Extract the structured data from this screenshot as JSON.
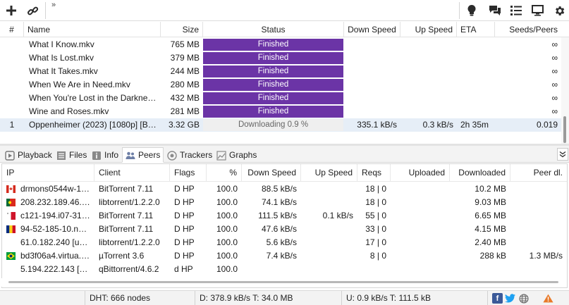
{
  "toolbar": {
    "left_icons": [
      "plus-icon",
      "link-icon"
    ],
    "overflow_label": "»",
    "right_icons": [
      "lightbulb-icon",
      "chat-icon",
      "list-icon",
      "monitor-icon",
      "gear-icon"
    ]
  },
  "torrents": {
    "columns": [
      "#",
      "Name",
      "Size",
      "Status",
      "Down Speed",
      "Up Speed",
      "ETA",
      "Seeds/Peers"
    ],
    "rows": [
      {
        "num": "",
        "name": "What I Know.mkv",
        "size": "765 MB",
        "status": "Finished",
        "state": "finished",
        "progress": 1.0,
        "down": "",
        "up": "",
        "eta": "",
        "seeds": "∞"
      },
      {
        "num": "",
        "name": "What Is Lost.mkv",
        "size": "379 MB",
        "status": "Finished",
        "state": "finished",
        "progress": 1.0,
        "down": "",
        "up": "",
        "eta": "",
        "seeds": "∞"
      },
      {
        "num": "",
        "name": "What It Takes.mkv",
        "size": "244 MB",
        "status": "Finished",
        "state": "finished",
        "progress": 1.0,
        "down": "",
        "up": "",
        "eta": "",
        "seeds": "∞"
      },
      {
        "num": "",
        "name": "When We Are in Need.mkv",
        "size": "280 MB",
        "status": "Finished",
        "state": "finished",
        "progress": 1.0,
        "down": "",
        "up": "",
        "eta": "",
        "seeds": "∞"
      },
      {
        "num": "",
        "name": "When You're Lost in the Darkness....",
        "size": "432 MB",
        "status": "Finished",
        "state": "finished",
        "progress": 1.0,
        "down": "",
        "up": "",
        "eta": "",
        "seeds": "∞"
      },
      {
        "num": "",
        "name": "Wine and Roses.mkv",
        "size": "281 MB",
        "status": "Finished",
        "state": "finished",
        "progress": 1.0,
        "down": "",
        "up": "",
        "eta": "",
        "seeds": "∞"
      },
      {
        "num": "1",
        "name": "Oppenheimer (2023) [1080p] [Blu...",
        "size": "3.32 GB",
        "status": "Downloading 0.9 %",
        "state": "downloading",
        "progress": 0.009,
        "down": "335.1 kB/s",
        "up": "0.3 kB/s",
        "eta": "2h 35m",
        "seeds": "0.019"
      }
    ]
  },
  "tabs": [
    {
      "label": "Playback",
      "icon": "playback-icon"
    },
    {
      "label": "Files",
      "icon": "files-icon"
    },
    {
      "label": "Info",
      "icon": "info-icon"
    },
    {
      "label": "Peers",
      "icon": "peers-icon",
      "active": true
    },
    {
      "label": "Trackers",
      "icon": "trackers-icon"
    },
    {
      "label": "Graphs",
      "icon": "graphs-icon"
    }
  ],
  "peers": {
    "columns": [
      "IP",
      "Client",
      "Flags",
      "%",
      "Down Speed",
      "Up Speed",
      "Reqs",
      "Uploaded",
      "Downloaded",
      "Peer dl."
    ],
    "rows": [
      {
        "flag": "ca",
        "ip": "drmons0544w-156....",
        "client": "BitTorrent 7.11",
        "flags": "D HP",
        "pct": "100.0",
        "down": "88.5 kB/s",
        "up": "",
        "reqs": "18 | 0",
        "uploaded": "",
        "downloaded": "10.2 MB",
        "peer_dl": ""
      },
      {
        "flag": "pt",
        "ip": "208.232.189.46.rev....",
        "client": "libtorrent/1.2.2.0",
        "flags": "D HP",
        "pct": "100.0",
        "down": "74.1 kB/s",
        "up": "",
        "reqs": "18 | 0",
        "uploaded": "",
        "downloaded": "9.03 MB",
        "peer_dl": ""
      },
      {
        "flag": "mt",
        "ip": "c121-194.i07-31.o...",
        "client": "BitTorrent 7.11",
        "flags": "D HP",
        "pct": "100.0",
        "down": "111.5 kB/s",
        "up": "0.1 kB/s",
        "reqs": "55 | 0",
        "uploaded": "",
        "downloaded": "6.65 MB",
        "peer_dl": ""
      },
      {
        "flag": "ro",
        "ip": "94-52-185-10.next...",
        "client": "BitTorrent 7.11",
        "flags": "D HP",
        "pct": "100.0",
        "down": "47.6 kB/s",
        "up": "",
        "reqs": "33 | 0",
        "uploaded": "",
        "downloaded": "4.15 MB",
        "peer_dl": ""
      },
      {
        "flag": "",
        "ip": "61.0.182.240 [uTP]",
        "client": "libtorrent/1.2.2.0",
        "flags": "D HP",
        "pct": "100.0",
        "down": "5.6 kB/s",
        "up": "",
        "reqs": "17 | 0",
        "uploaded": "",
        "downloaded": "2.40 MB",
        "peer_dl": ""
      },
      {
        "flag": "br",
        "ip": "bd3f06a4.virtua.co....",
        "client": "µTorrent 3.6",
        "flags": "D HP",
        "pct": "100.0",
        "down": "7.4 kB/s",
        "up": "",
        "reqs": "8 | 0",
        "uploaded": "",
        "downloaded": "288 kB",
        "peer_dl": "1.3 MB/s"
      },
      {
        "flag": "",
        "ip": "5.194.222.143 [uTP]",
        "client": "qBittorrent/4.6.2",
        "flags": "d HP",
        "pct": "100.0",
        "down": "",
        "up": "",
        "reqs": "",
        "uploaded": "",
        "downloaded": "",
        "peer_dl": ""
      }
    ]
  },
  "statusbar": {
    "dht": "DHT: 666 nodes",
    "download": "D: 378.9 kB/s T: 34.0 MB",
    "upload": "U: 0.9 kB/s T: 111.5 kB",
    "icons": [
      "facebook-icon",
      "twitter-icon",
      "globe-icon",
      "warning-icon"
    ]
  },
  "colors": {
    "finished": "#6b34a6",
    "selected_row": "#e6eef7"
  }
}
